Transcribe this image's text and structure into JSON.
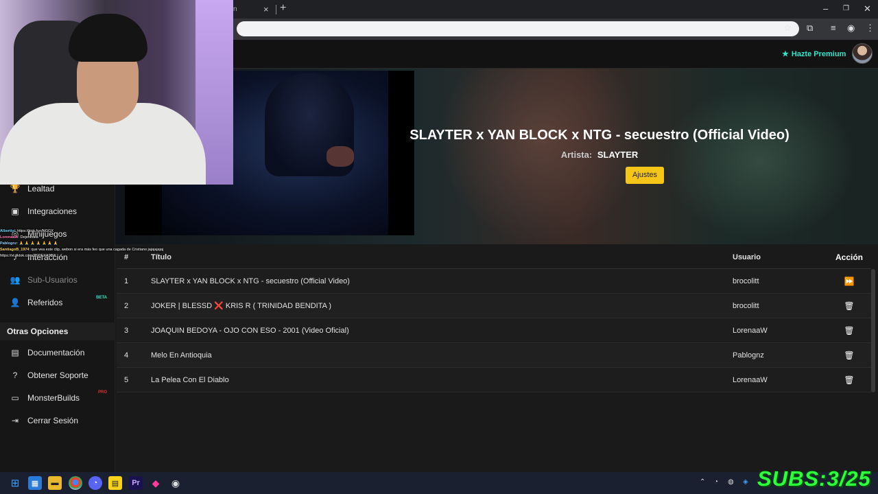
{
  "browser": {
    "tab_fragment": "n",
    "tab_close": "×",
    "new_tab": "+",
    "window_controls": [
      "–",
      "❐",
      "✕"
    ],
    "toolbar_icons": [
      "star-icon",
      "extensions-icon",
      "media-icon",
      "profile-icon",
      "menu-icon"
    ]
  },
  "header": {
    "premium_label": "Hazte Premium",
    "premium_icon": "star-icon"
  },
  "sidebar": {
    "items": [
      {
        "label": "Lealtad",
        "icon": "trophy-icon"
      },
      {
        "label": "Integraciones",
        "icon": "integration-icon"
      },
      {
        "label": "Minijuegos",
        "icon": "gamepad-icon"
      },
      {
        "label": "Interacción",
        "icon": "interaction-icon"
      },
      {
        "label": "Sub-Usuarios",
        "icon": "users-icon",
        "muted": true
      },
      {
        "label": "Referidos",
        "icon": "referrals-icon",
        "badge": "BETA"
      }
    ],
    "section_title": "Otras Opciones",
    "other_items": [
      {
        "label": "Documentación",
        "icon": "book-icon"
      },
      {
        "label": "Obtener Soporte",
        "icon": "help-icon"
      },
      {
        "label": "MonsterBuilds",
        "icon": "monitor-icon",
        "badge": "PRO"
      },
      {
        "label": "Cerrar Sesión",
        "icon": "logout-icon"
      }
    ],
    "badge_colors": {
      "BETA": "#2ee6c9",
      "PRO": "#e03030"
    }
  },
  "now_playing": {
    "title": "SLAYTER x YAN BLOCK x NTG - secuestro (Official Video)",
    "artist_label": "Artista:",
    "artist": "SLAYTER",
    "settings_button": "Ajustes"
  },
  "queue": {
    "columns": [
      "#",
      "Título",
      "Usuario",
      "Acción"
    ],
    "rows": [
      {
        "n": "1",
        "title": "SLAYTER x YAN BLOCK x NTG - secuestro (Official Video)",
        "user": "brocolitt",
        "action": "skip-icon",
        "glyph": "⏩"
      },
      {
        "n": "2",
        "title": "JOKER | BLESSD ❌ KRIS R ( TRINIDAD BENDITA )",
        "user": "brocolitt",
        "action": "trash-icon",
        "glyph": "🗑"
      },
      {
        "n": "3",
        "title": "JOAQUIN BEDOYA - OJO CON ESO - 2001 (Video Oficial)",
        "user": "LorenaaW",
        "action": "trash-icon",
        "glyph": "🗑"
      },
      {
        "n": "4",
        "title": "Melo En Antioquia",
        "user": "Pablognz",
        "action": "trash-icon",
        "glyph": "🗑"
      },
      {
        "n": "5",
        "title": "La Pelea Con El Diablo",
        "user": "LorenaaW",
        "action": "trash-icon",
        "glyph": "🗑"
      }
    ]
  },
  "chat": {
    "lines": [
      {
        "user": "Albertiyi",
        "text": ": https://kick.fun/NGGX",
        "color": "#6fd3ff"
      },
      {
        "user": "LorenaaW",
        "text": ": Dejenloala",
        "color": "#ff7ab6"
      },
      {
        "user": "Pablognz",
        "text": ": 🙏 🙏 🙏 🙏 🙏 🙏 🙏",
        "color": "#8fd0ff"
      },
      {
        "user": "SantiagoB_1974",
        "text": ": que vea este clip, webon si era más feo que una cagada de Cristiano jajajajajaj https://vt.tiktok.com/ZSDEXA9fM/",
        "color": "#ffd35a"
      }
    ]
  },
  "overlay": {
    "subs_counter": "SUBS:3/25",
    "subs_color": "#2cff3c"
  },
  "taskbar": {
    "apps": [
      "windows-start-icon",
      "photos-icon",
      "file-explorer-icon",
      "chrome-icon",
      "discord-icon",
      "sticky-notes-icon",
      "premiere-pro-icon",
      "app-pink-icon",
      "obs-icon"
    ],
    "tray": [
      "chevron-up-icon",
      "discord-tray-icon",
      "steam-icon",
      "network-icon",
      "shield-icon",
      "wifi-icon",
      "volume-icon"
    ]
  }
}
